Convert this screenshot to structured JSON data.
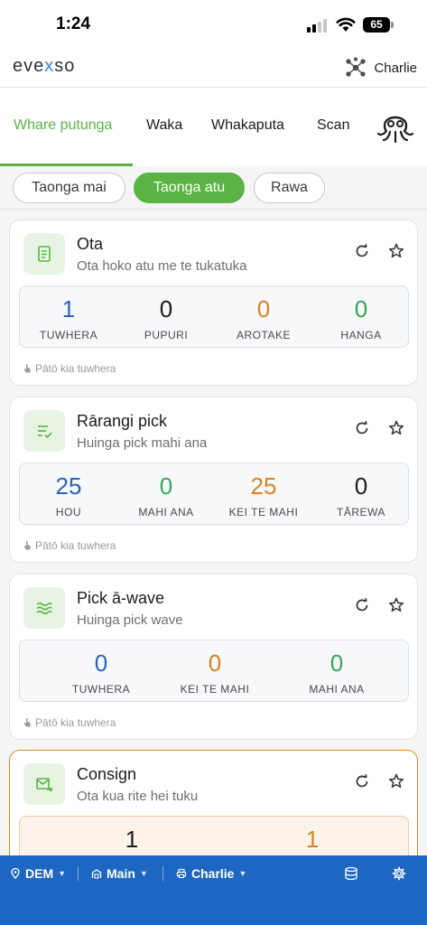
{
  "status_bar": {
    "time": "1:24",
    "battery": "65"
  },
  "header": {
    "logo_pre": "eve",
    "logo_x": "x",
    "logo_post": "so",
    "user": "Charlie"
  },
  "tabs": [
    "Whare putunga",
    "Waka",
    "Whakaputa",
    "Scan"
  ],
  "chips": [
    "Taonga mai",
    "Taonga atu",
    "Rawa"
  ],
  "cards": [
    {
      "title": "Ota",
      "subtitle": "Ota hoko atu me te tukatuka",
      "stats": [
        {
          "value": "1",
          "label": "TUWHERA"
        },
        {
          "value": "0",
          "label": "PUPURI"
        },
        {
          "value": "0",
          "label": "AROTAKE"
        },
        {
          "value": "0",
          "label": "HANGA"
        }
      ],
      "footer": "Pātō kia tuwhera"
    },
    {
      "title": "Rārangi pick",
      "subtitle": "Huinga pick mahi ana",
      "stats": [
        {
          "value": "25",
          "label": "HOU"
        },
        {
          "value": "0",
          "label": "MAHI ANA"
        },
        {
          "value": "25",
          "label": "KEI TE MAHI"
        },
        {
          "value": "0",
          "label": "TĀREWA"
        }
      ],
      "footer": "Pātō kia tuwhera"
    },
    {
      "title": "Pick ā-wave",
      "subtitle": "Huinga pick wave",
      "stats": [
        {
          "value": "0",
          "label": "TUWHERA"
        },
        {
          "value": "0",
          "label": "KEI TE MAHI"
        },
        {
          "value": "0",
          "label": "MAHI ANA"
        }
      ],
      "footer": "Pātō kia tuwhera"
    },
    {
      "title": "Consign",
      "subtitle": "Ota kua rite hei tuku",
      "stats": [
        {
          "value": "1"
        },
        {
          "value": "1"
        }
      ]
    }
  ],
  "bottom_bar": {
    "location": "DEM",
    "warehouse": "Main",
    "printer": "Charlie"
  },
  "colors": {
    "accent": "#5ab344",
    "bottom_bar": "#1d67c3",
    "stat_blue": "#2d64b8",
    "stat_orange": "#d88322",
    "stat_green": "#3aa55a"
  }
}
